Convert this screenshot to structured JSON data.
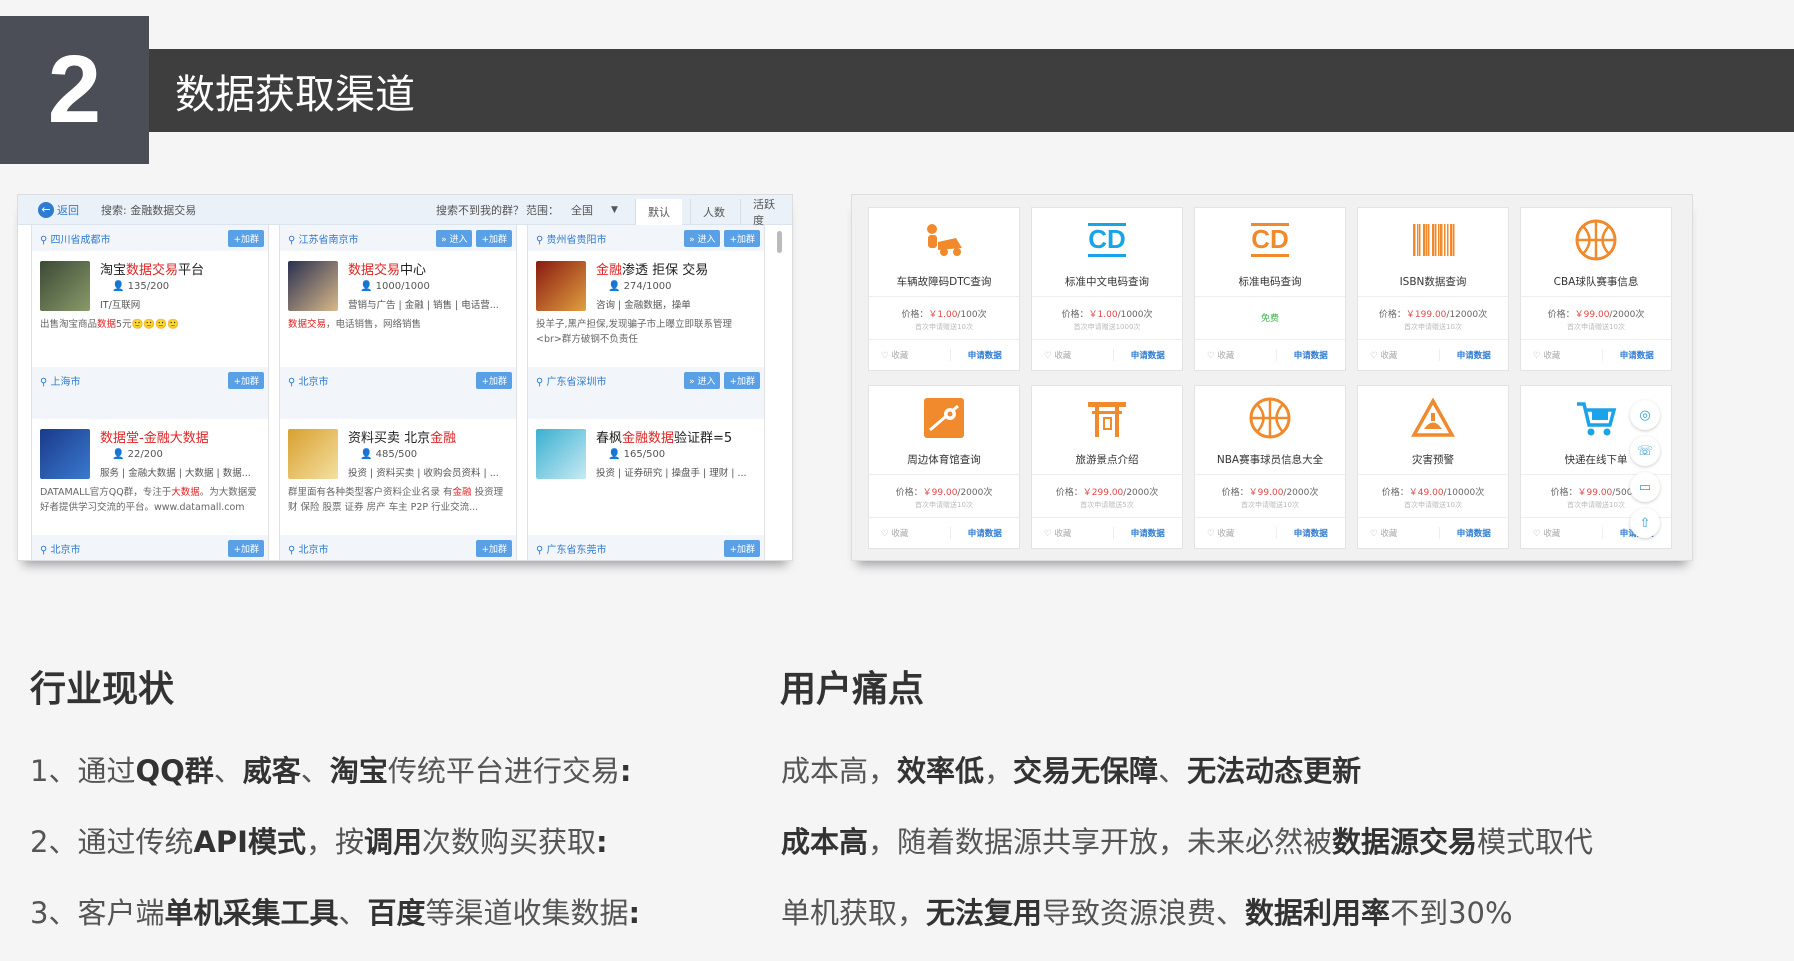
{
  "header": {
    "number": "2",
    "title": "数据获取渠道"
  },
  "left_shot": {
    "back": "返回",
    "keyword": "搜索: 金融数据交易",
    "not_found": "搜索不到我的群？",
    "range_label": "范围：",
    "range_value": "全国",
    "sort_tabs": [
      "默认",
      "人数",
      "活跃度"
    ],
    "join_label": "+加群",
    "enter_label": "» 进入",
    "groups": [
      {
        "top_loc": "四川省成都市",
        "name_parts": [
          "淘宝",
          "数据交易",
          "平台"
        ],
        "count": "135/200",
        "tags": "IT/互联网",
        "desc_parts": [
          "出售淘宝商品",
          "数据",
          "5元🙂🙂🙂🙂"
        ],
        "bottom_loc": "上海市",
        "enter_top": false,
        "enter_bottom": false
      },
      {
        "top_loc": "江苏省南京市",
        "name_parts": [
          "",
          "数据交易",
          "中心"
        ],
        "count": "1000/1000",
        "tags": "营销与广告 | 金融 | 销售 | 电话营...",
        "desc_parts": [
          "",
          "数据交易",
          "，电话销售，网络销售"
        ],
        "bottom_loc": "北京市",
        "enter_top": true,
        "enter_bottom": false
      },
      {
        "top_loc": "贵州省贵阳市",
        "name_parts": [
          "",
          "金融",
          "渗透 拒保 交易"
        ],
        "count": "274/1000",
        "tags": "咨询 | 金融数据，操单",
        "desc_parts": [
          "投羊子,黑产担保,发现骗子市上曝立即联系管理 <br>群方破钢不负责任",
          "",
          ""
        ],
        "bottom_loc": "广东省深圳市",
        "enter_top": true,
        "enter_bottom": true
      },
      {
        "top_loc": "",
        "name_parts": [
          "",
          "数据堂-金融大数据",
          ""
        ],
        "count": "22/200",
        "tags": "服务 | 金融大数据 | 大数据 | 数据...",
        "desc_parts": [
          "DATAMALL官方QQ群，专注于",
          "大数据",
          "。为大数据爱好者提供学习交流的平台。www.datamall.com"
        ],
        "bottom_loc": "北京市",
        "enter_top": false,
        "enter_bottom": false
      },
      {
        "top_loc": "",
        "name_parts": [
          "资料买卖 北京",
          "金融",
          ""
        ],
        "count": "485/500",
        "tags": "投资 | 资料买卖 | 收购会员资料 | ...",
        "desc_parts": [
          "群里面有各种类型客户资料企业名录 有",
          "金融",
          " 投资理财 保险 股票 证券 房产 车主 P2P 行业交流..."
        ],
        "bottom_loc": "北京市",
        "enter_top": false,
        "enter_bottom": false
      },
      {
        "top_loc": "",
        "name_parts": [
          "春枫",
          "金融数据",
          "验证群=5"
        ],
        "count": "165/500",
        "tags": "投资 | 证券研究 | 操盘手 | 理财 | ...",
        "desc_parts": [
          "",
          "",
          ""
        ],
        "bottom_loc": "广东省东莞市",
        "enter_top": false,
        "enter_bottom": false
      }
    ]
  },
  "right_shot": {
    "fav_label": "♡ 收藏",
    "apply_label": "申请数据",
    "cards": [
      {
        "name": "车辆故障码DTC查询",
        "price_prefix": "价格：",
        "price": "￥1.00",
        "unit": "/100次",
        "sub": "首次申请赠送10次",
        "icon": "car-repair-icon",
        "free": ""
      },
      {
        "name": "标准中文电码查询",
        "price_prefix": "价格：",
        "price": "￥1.00",
        "unit": "/1000次",
        "sub": "首次申请赠送1000次",
        "icon": "cd-icon-blue",
        "free": ""
      },
      {
        "name": "标准电码查询",
        "price_prefix": "",
        "price": "",
        "unit": "",
        "sub": "",
        "icon": "cd-icon-orange",
        "free": "免费"
      },
      {
        "name": "ISBN数据查询",
        "price_prefix": "价格：",
        "price": "￥199.00",
        "unit": "/12000次",
        "sub": "首次申请赠送10次",
        "icon": "barcode-icon",
        "free": ""
      },
      {
        "name": "CBA球队赛事信息",
        "price_prefix": "价格：",
        "price": "￥99.00",
        "unit": "/2000次",
        "sub": "首次申请赠送10次",
        "icon": "basketball-icon",
        "free": ""
      },
      {
        "name": "周边体育馆查询",
        "price_prefix": "价格：",
        "price": "￥99.00",
        "unit": "/2000次",
        "sub": "首次申请赠送10次",
        "icon": "map-pin-icon",
        "free": ""
      },
      {
        "name": "旅游景点介绍",
        "price_prefix": "价格：",
        "price": "￥299.00",
        "unit": "/2000次",
        "sub": "首次申请赠送5次",
        "icon": "torii-icon",
        "free": ""
      },
      {
        "name": "NBA赛事球员信息大全",
        "price_prefix": "价格：",
        "price": "￥99.00",
        "unit": "/2000次",
        "sub": "首次申请赠送10次",
        "icon": "basketball-icon",
        "free": ""
      },
      {
        "name": "灾害预警",
        "price_prefix": "价格：",
        "price": "￥49.00",
        "unit": "/10000次",
        "sub": "首次申请赠送10次",
        "icon": "warning-icon",
        "free": ""
      },
      {
        "name": "快递在线下单",
        "price_prefix": "价格：",
        "price": "￥99.00",
        "unit": "/500次",
        "sub": "首次申请赠送10次",
        "icon": "cart-icon",
        "free": ""
      }
    ],
    "float_icons": [
      "qq-icon",
      "phone-icon",
      "chat-icon",
      "top-icon"
    ]
  },
  "industry": {
    "heading": "行业现状",
    "lines": [
      [
        {
          "t": "1、通过",
          "b": false
        },
        {
          "t": "QQ群",
          "b": true
        },
        {
          "t": "、",
          "b": false
        },
        {
          "t": "威客",
          "b": true
        },
        {
          "t": "、",
          "b": false
        },
        {
          "t": "淘宝",
          "b": true
        },
        {
          "t": "传统平台进行交易",
          "b": false
        },
        {
          "t": ":",
          "b": true
        }
      ],
      [
        {
          "t": "2、通过传统",
          "b": false
        },
        {
          "t": "API模式",
          "b": true
        },
        {
          "t": "，按",
          "b": false
        },
        {
          "t": "调用",
          "b": true
        },
        {
          "t": "次数购买获取",
          "b": false
        },
        {
          "t": ":",
          "b": true
        }
      ],
      [
        {
          "t": "3、客户端",
          "b": false
        },
        {
          "t": "单机采集工具",
          "b": true
        },
        {
          "t": "、",
          "b": false
        },
        {
          "t": "百度",
          "b": true
        },
        {
          "t": "等渠道收集数据",
          "b": false
        },
        {
          "t": ":",
          "b": true
        }
      ]
    ]
  },
  "pain": {
    "heading": "用户痛点",
    "lines": [
      [
        {
          "t": "成本高，",
          "b": false
        },
        {
          "t": "效率低",
          "b": true
        },
        {
          "t": "，",
          "b": false
        },
        {
          "t": "交易无保障",
          "b": true
        },
        {
          "t": "、",
          "b": false
        },
        {
          "t": "无法动态更新",
          "b": true
        }
      ],
      [
        {
          "t": "成本高",
          "b": true
        },
        {
          "t": "，随着数据源共享开放，未来必然被",
          "b": false
        },
        {
          "t": "数据源交易",
          "b": true
        },
        {
          "t": "模式取代",
          "b": false
        }
      ],
      [
        {
          "t": "单机获取，",
          "b": false
        },
        {
          "t": "无法复用",
          "b": true
        },
        {
          "t": "导致资源浪费、",
          "b": false
        },
        {
          "t": "数据利用率",
          "b": true
        },
        {
          "t": "不到30%",
          "b": false
        }
      ]
    ]
  },
  "colors": {
    "accent_blue": "#2f7bd1",
    "highlight_red": "#e02424",
    "icon_orange": "#f08a2c",
    "icon_blue": "#1aa3e8",
    "header_dark": "#3e3e3f"
  }
}
